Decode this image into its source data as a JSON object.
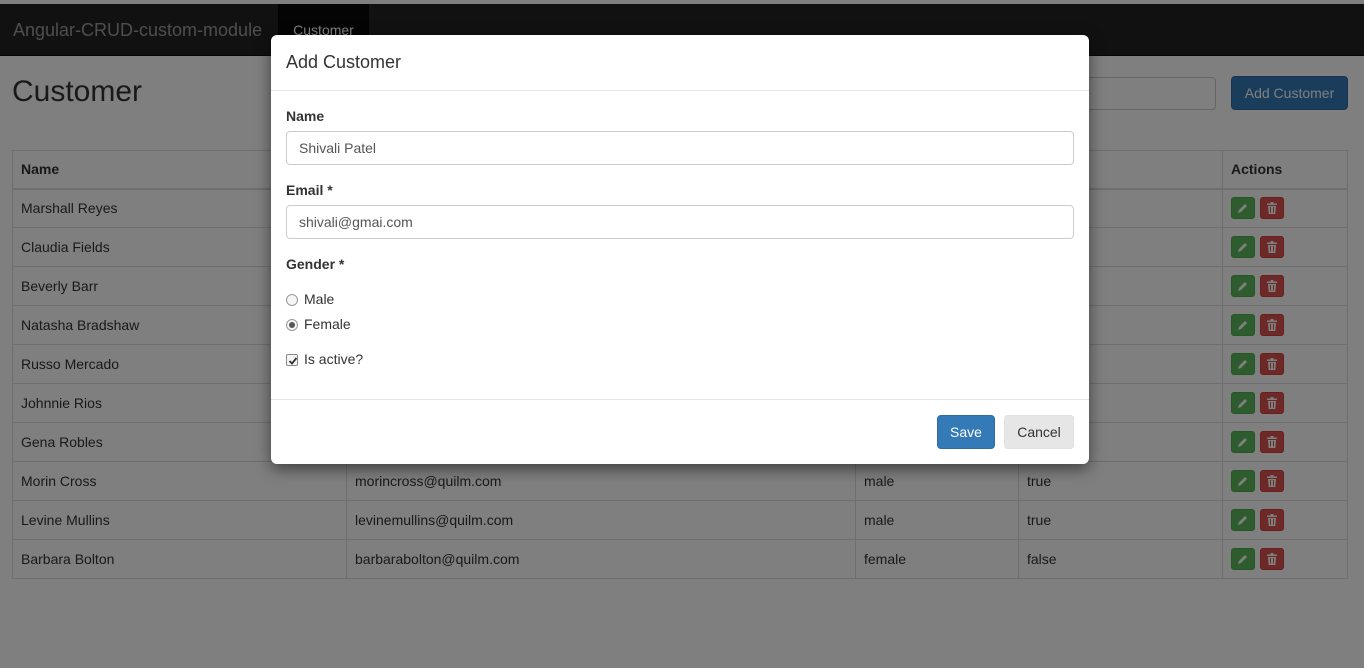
{
  "navbar": {
    "brand": "Angular-CRUD-custom-module",
    "active_item": "Customer"
  },
  "page": {
    "title": "Customer",
    "add_button": "Add Customer"
  },
  "table": {
    "headers": {
      "name": "Name",
      "email": "",
      "gender": "",
      "active": "",
      "actions": "Actions"
    },
    "rows": [
      {
        "name": "Marshall Reyes",
        "email": "",
        "gender": "",
        "active": ""
      },
      {
        "name": "Claudia Fields",
        "email": "",
        "gender": "",
        "active": ""
      },
      {
        "name": "Beverly Barr",
        "email": "",
        "gender": "",
        "active": ""
      },
      {
        "name": "Natasha Bradshaw",
        "email": "",
        "gender": "",
        "active": ""
      },
      {
        "name": "Russo Mercado",
        "email": "",
        "gender": "",
        "active": ""
      },
      {
        "name": "Johnnie Rios",
        "email": "",
        "gender": "",
        "active": ""
      },
      {
        "name": "Gena Robles",
        "email": "",
        "gender": "",
        "active": ""
      },
      {
        "name": "Morin Cross",
        "email": "morincross@quilm.com",
        "gender": "male",
        "active": "true"
      },
      {
        "name": "Levine Mullins",
        "email": "levinemullins@quilm.com",
        "gender": "male",
        "active": "true"
      },
      {
        "name": "Barbara Bolton",
        "email": "barbarabolton@quilm.com",
        "gender": "female",
        "active": "false"
      }
    ]
  },
  "modal": {
    "title": "Add Customer",
    "name_label": "Name",
    "name_value": "Shivali Patel",
    "email_label": "Email *",
    "email_value": "shivali@gmai.com",
    "gender_label": "Gender *",
    "gender_male": "Male",
    "gender_female": "Female",
    "gender_selected": "Female",
    "active_label": "Is active?",
    "active_checked": true,
    "save_label": "Save",
    "cancel_label": "Cancel"
  },
  "icons": {
    "edit": "pencil-icon",
    "delete": "trash-icon"
  },
  "colors": {
    "primary": "#337ab7",
    "success": "#5cb85c",
    "danger": "#d9534f",
    "navbar": "#222222"
  }
}
